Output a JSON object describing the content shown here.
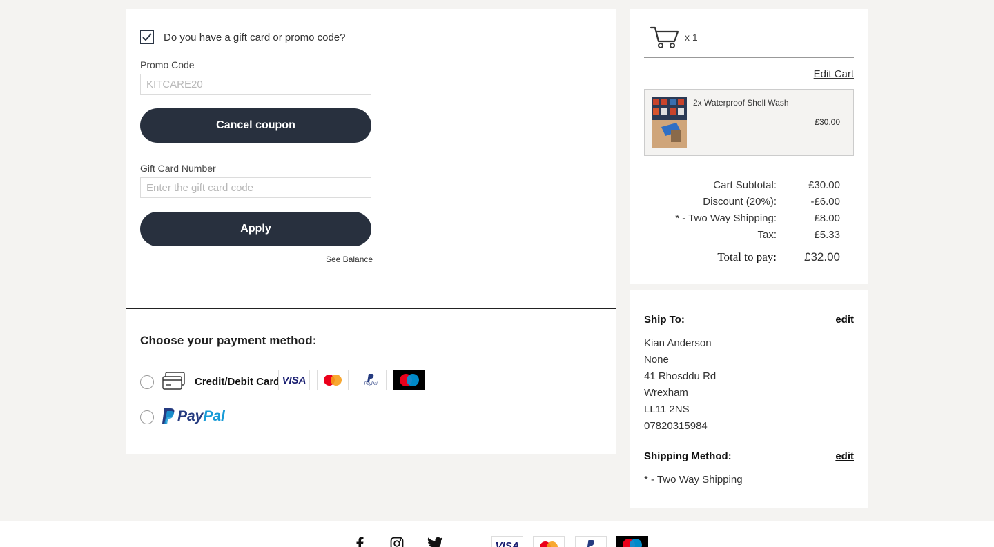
{
  "promo": {
    "question": "Do you have a gift card or promo code?",
    "checked": true,
    "promo_label": "Promo Code",
    "promo_placeholder": "KITCARE20",
    "cancel_label": "Cancel coupon",
    "gift_label": "Gift Card Number",
    "gift_placeholder": "Enter the gift card code",
    "apply_label": "Apply",
    "see_balance": "See Balance"
  },
  "payment": {
    "title": "Choose your payment method:",
    "card_label": "Credit/Debit Card",
    "card_logos": [
      "visa",
      "mastercard",
      "paypal",
      "maestro"
    ],
    "visa_text": "VISA",
    "paypal_small": "PayPal",
    "maestro_small": "maestro",
    "paypal_pay": "Pay",
    "paypal_pal": "Pal"
  },
  "cart": {
    "count_text": "x 1",
    "edit_cart": "Edit Cart",
    "item_name": "2x Waterproof Shell Wash",
    "item_price": "£30.00"
  },
  "totals": {
    "rows": [
      {
        "label": "Cart Subtotal:",
        "value": "£30.00"
      },
      {
        "label": "Discount (20%):",
        "value": "-£6.00"
      },
      {
        "label": "* - Two Way Shipping:",
        "value": "£8.00"
      },
      {
        "label": "Tax:",
        "value": "£5.33"
      }
    ],
    "total_label": "Total to pay:",
    "total_value": "£32.00"
  },
  "shipping": {
    "ship_to_label": "Ship To:",
    "edit_label": "edit",
    "address": [
      "Kian Anderson",
      "None",
      "41 Rhosddu Rd",
      "Wrexham",
      "LL11 2NS",
      "07820315984"
    ],
    "method_label": "Shipping Method:",
    "method_value": "* - Two Way Shipping"
  },
  "colors": {
    "button_bg": "#28303e",
    "page_bg": "#f4f3f1",
    "paypal_dark": "#253b80",
    "paypal_light": "#179bd7"
  },
  "footer": {
    "social": [
      "facebook-icon",
      "instagram-icon",
      "twitter-icon"
    ],
    "cards": [
      "visa",
      "mastercard",
      "paypal",
      "maestro"
    ]
  }
}
